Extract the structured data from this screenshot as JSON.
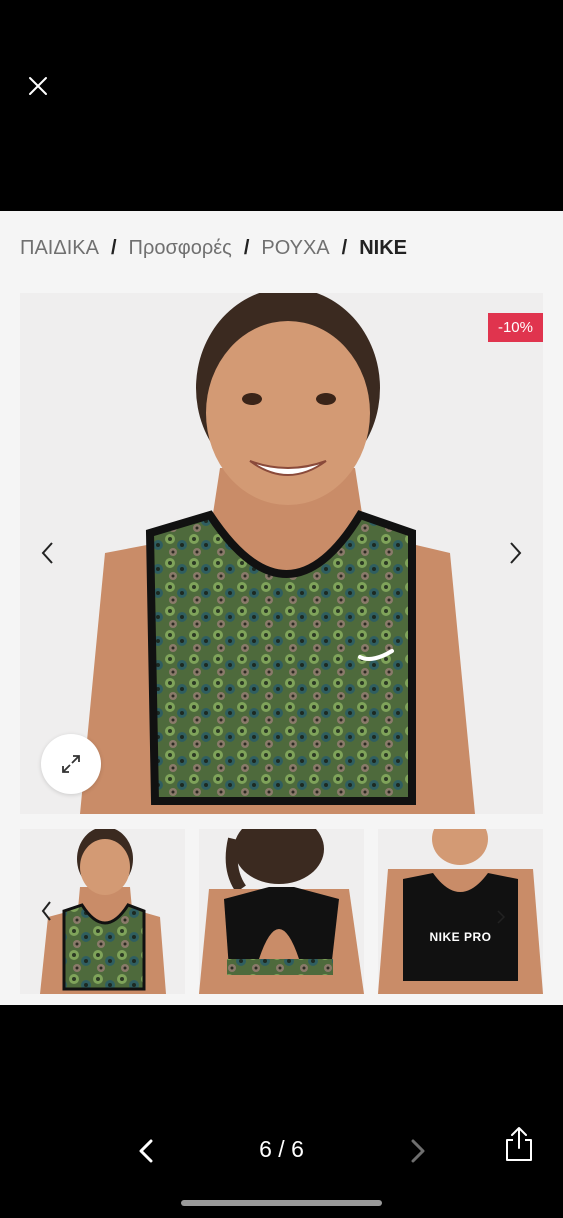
{
  "breadcrumb": {
    "items": [
      "ΠΑΙΔΙΚΑ",
      "Προσφορές",
      "ΡΟΥΧΑ"
    ],
    "separator": "/",
    "current": "NIKE"
  },
  "product": {
    "discount_badge": "-10%",
    "thumb3_print": "NIKE PRO"
  },
  "viewer": {
    "counter": "6 / 6"
  },
  "icons": {
    "close": "close-icon",
    "expand": "expand-icon",
    "prev": "chevron-left-icon",
    "next": "chevron-right-icon",
    "share": "share-icon"
  }
}
